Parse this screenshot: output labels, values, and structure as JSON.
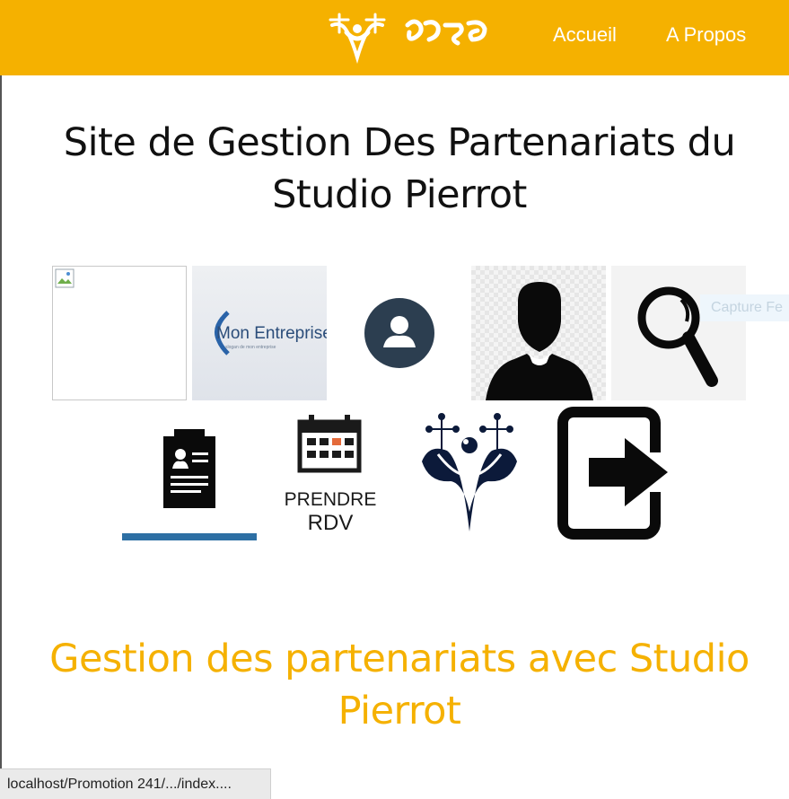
{
  "header": {
    "logo_alt": "Studio Pierrot logo",
    "nav": {
      "home": "Accueil",
      "about": "A Propos"
    },
    "color": "#f5b100"
  },
  "main": {
    "title": "Site de Gestion Des Partenariats du Studio Pierrot",
    "subtitle": "Gestion des partenariats avec Studio Pierrot",
    "capture_hint": "Capture Fe",
    "company_logo": {
      "name": "Mon Entreprise"
    },
    "calendar": {
      "label_line1": "PRENDRE",
      "label_line2": "RDV"
    },
    "icons": [
      "broken-image-icon",
      "company-logo",
      "user-avatar-icon",
      "user-silhouette-icon",
      "search-icon",
      "contact-card-icon",
      "calendar-appointment-icon",
      "studio-pierrot-icon",
      "logout-icon"
    ]
  },
  "statusbar": {
    "url": "localhost/Promotion 241/.../index...."
  }
}
